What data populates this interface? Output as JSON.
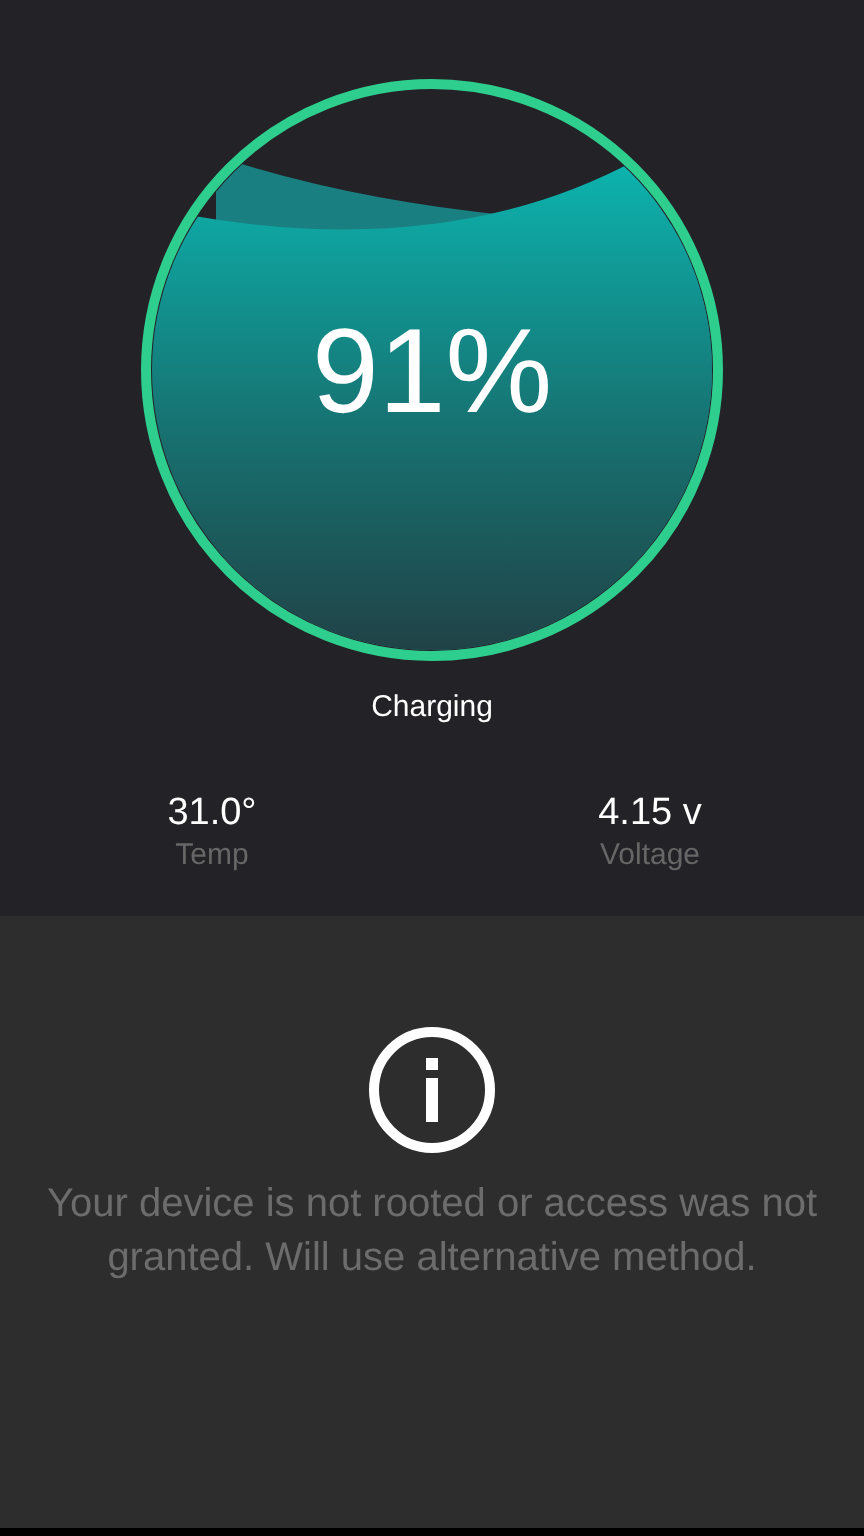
{
  "battery": {
    "percent": "91%",
    "status": "Charging"
  },
  "stats": [
    {
      "value": "31.0°",
      "label": "Temp"
    },
    {
      "value": "4.15 v",
      "label": "Voltage"
    }
  ],
  "notice": {
    "message": "Your device is not rooted or access was not granted. Will use alternative method."
  }
}
